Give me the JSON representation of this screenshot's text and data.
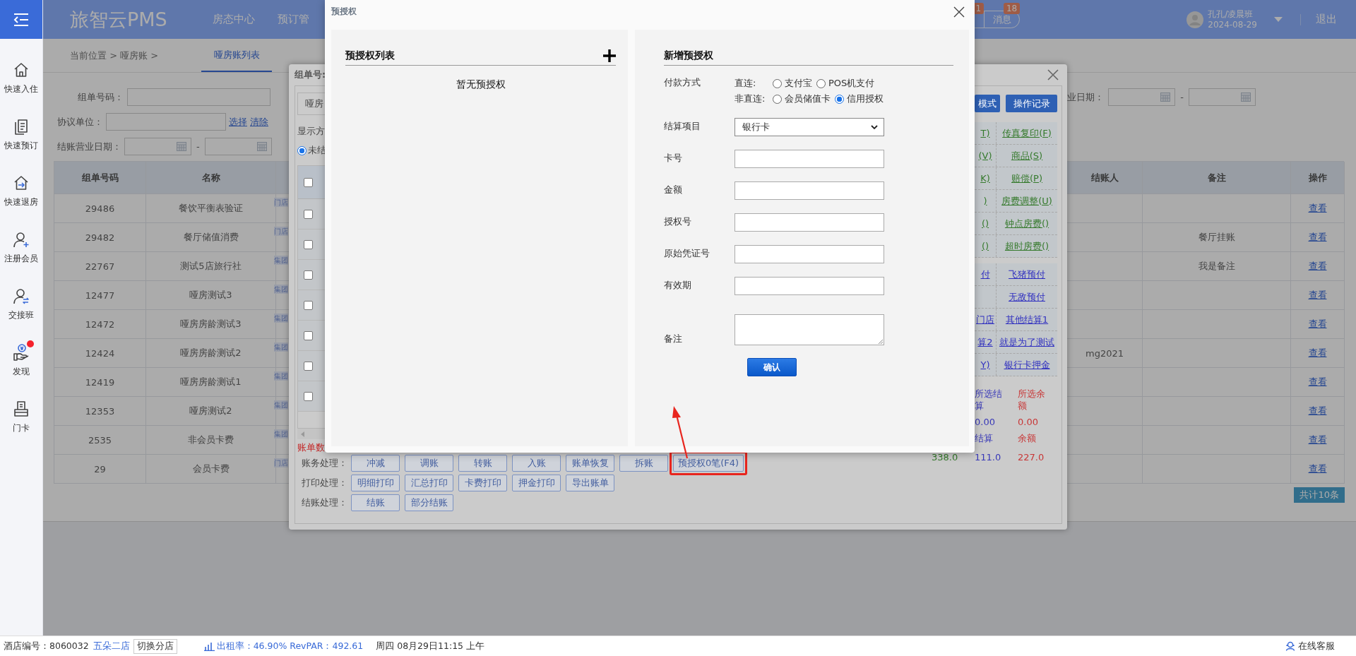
{
  "sidebar": {
    "items": [
      {
        "label": "快速入住",
        "alert": false
      },
      {
        "label": "快速预订",
        "alert": false
      },
      {
        "label": "快速退房",
        "alert": false
      },
      {
        "label": "注册会员",
        "alert": false
      },
      {
        "label": "交接班",
        "alert": false
      },
      {
        "label": "发现",
        "alert": true
      },
      {
        "label": "门卡",
        "alert": false
      }
    ]
  },
  "top_bar": {
    "logo": "旅智云PMS",
    "nav": [
      "房态中心",
      "预订管"
    ],
    "pills": [
      {
        "count": "1"
      },
      {
        "label": "消息",
        "count": "18"
      }
    ],
    "user": {
      "name": "孔孔/凌晨班",
      "date": "2024-08-29"
    },
    "logout": "退出"
  },
  "breadcrumb": {
    "path": "当前位置 > 哑房账 >",
    "tabs": [
      {
        "label": "哑房账列表",
        "selected": true
      }
    ]
  },
  "filters": {
    "group_no": {
      "label": "组单号码："
    },
    "agreement": {
      "label": "协议单位：",
      "links": [
        "选择",
        "清除"
      ]
    },
    "checkout_date": {
      "label": "结账营业日期：",
      "separator": "-"
    },
    "business_date": {
      "label": "业日期：",
      "separator": "-"
    }
  },
  "table": {
    "columns": [
      "组单号码",
      "名称",
      "结账人",
      "备注",
      "操作"
    ],
    "rows": [
      {
        "id": "29486",
        "name": "餐饮平衡表验证",
        "tag": "门店",
        "action": "查看"
      },
      {
        "id": "29482",
        "name": "餐厅储值消费",
        "tag": "门店",
        "note": "餐厅挂账",
        "action": "查看"
      },
      {
        "id": "22767",
        "name": "测试5店旅行社",
        "tag": "集团",
        "note": "我是备注",
        "action": "查看"
      },
      {
        "id": "12477",
        "name": "哑房测试3",
        "tag": "集团",
        "action": "查看"
      },
      {
        "id": "12472",
        "name": "哑房房龄测试3",
        "tag": "集团",
        "action": "查看"
      },
      {
        "id": "12424",
        "name": "哑房房龄测试2",
        "tag": "集团",
        "settler": "mg2021",
        "action": "查看"
      },
      {
        "id": "12419",
        "name": "哑房房龄测试1",
        "tag": "集团",
        "action": "查看"
      },
      {
        "id": "12353",
        "name": "哑房测试2",
        "tag": "集团",
        "action": "查看"
      },
      {
        "id": "2535",
        "name": "非会员卡费",
        "tag": "集团",
        "action": "查看"
      },
      {
        "id": "29",
        "name": "会员卡费",
        "tag": "门店",
        "action": "查看"
      }
    ]
  },
  "total": "共计10条",
  "bill_dialog": {
    "title": "组单号:",
    "tab": "哑房",
    "display_label": "显示方",
    "filter": {
      "label": "未结",
      "selected": true
    },
    "header_checkbox": {
      "checked": false
    },
    "rows": [
      {
        "checked": false
      },
      {
        "checked": false
      },
      {
        "checked": false
      },
      {
        "checked": false
      },
      {
        "checked": false
      },
      {
        "checked": false
      },
      {
        "checked": false
      }
    ],
    "mode_button": "模式",
    "log_button": "操作记录",
    "link_groups": [
      {
        "links": [
          {
            "fragment": "T)",
            "label": "传真复印(F)",
            "color": "#357a2c"
          },
          {
            "fragment": "(V)",
            "label": "商品(S)",
            "color": "#357a2c"
          },
          {
            "fragment": "K)",
            "label": "赔偿(P)",
            "color": "#357a2c"
          },
          {
            "fragment": ")",
            "label": "房费调整(U)",
            "color": "#357a2c"
          },
          {
            "fragment": "()",
            "label": "钟点房费()",
            "color": "#357a2c"
          },
          {
            "fragment": "()",
            "label": "超时房费()",
            "color": "#357a2c"
          }
        ]
      },
      {
        "links": [
          {
            "fragment": "付",
            "label": "飞猪预付",
            "color": "#2f2fc0"
          },
          {
            "label": "无敌预付",
            "color": "#2f2fc0"
          },
          {
            "fragment": "门店",
            "label": "其他结算1",
            "color": "#2f2fc0"
          },
          {
            "fragment": "算2",
            "label": "就是为了测试",
            "color": "#2f2fc0"
          },
          {
            "fragment": "Y)",
            "label": "银行卡押金",
            "color": "#2f2fc0"
          }
        ]
      }
    ],
    "selected_totals": [
      {
        "label": "所选结算",
        "value": "0.00",
        "color": "#3838b8"
      },
      {
        "label": "所选余额",
        "value": "0.00",
        "color": "#c83636"
      }
    ],
    "totals": [
      {
        "value": "338.0",
        "color": "#357a2c"
      },
      {
        "label": "结算",
        "value": "111.0",
        "color": "#3838b8"
      },
      {
        "label": "余额",
        "value": "227.0",
        "color": "#c83636"
      }
    ],
    "notice": "账单数",
    "actions": [
      {
        "label": "账务处理：",
        "buttons": [
          {
            "label": "冲减",
            "highlighted": false
          },
          {
            "label": "调账",
            "highlighted": false
          },
          {
            "label": "转账",
            "highlighted": false
          },
          {
            "label": "入账",
            "highlighted": false
          },
          {
            "label": "账单恢复",
            "highlighted": false
          },
          {
            "label": "拆账",
            "highlighted": false
          },
          {
            "label": "预授权0笔(F4)",
            "highlighted": true
          }
        ]
      },
      {
        "label": "打印处理：",
        "buttons": [
          {
            "label": "明细打印",
            "highlighted": false
          },
          {
            "label": "汇总打印",
            "highlighted": false
          },
          {
            "label": "卡费打印",
            "highlighted": false
          },
          {
            "label": "押金打印",
            "highlighted": false
          },
          {
            "label": "导出账单",
            "highlighted": false
          }
        ]
      },
      {
        "label": "结账处理：",
        "buttons": [
          {
            "label": "结账",
            "highlighted": false
          },
          {
            "label": "部分结账",
            "highlighted": false
          }
        ]
      }
    ]
  },
  "preauth_dialog": {
    "title": "预授权",
    "list_heading": "预授权列表",
    "empty_text": "暂无预授权",
    "form_heading": "新增预授权",
    "payment": {
      "label": "付款方式",
      "groups": [
        {
          "label": "直连:",
          "options": [
            {
              "label": "支付宝",
              "selected": false
            },
            {
              "label": "POS机支付",
              "selected": false
            }
          ]
        },
        {
          "label": "非直连:",
          "options": [
            {
              "label": "会员储值卡",
              "selected": false
            },
            {
              "label": "信用授权",
              "selected": true
            }
          ]
        }
      ]
    },
    "fields": [
      {
        "label": "结算项目",
        "kind": "select",
        "value": "银行卡"
      },
      {
        "label": "卡号",
        "kind": "input"
      },
      {
        "label": "金额",
        "kind": "input"
      },
      {
        "label": "授权号",
        "kind": "input"
      },
      {
        "label": "原始凭证号",
        "kind": "input"
      },
      {
        "label": "有效期",
        "kind": "input"
      },
      {
        "label": "备注",
        "kind": "textarea"
      }
    ],
    "confirm": "确认"
  },
  "status_bar": {
    "hotel": "酒店编号：8060032",
    "branch": "五朵二店",
    "switch": "切换分店",
    "occupancy": "出租率：46.90% RevPAR：492.61",
    "datetime": "周四 08月29日11:15 上午",
    "support": "在线客服"
  }
}
